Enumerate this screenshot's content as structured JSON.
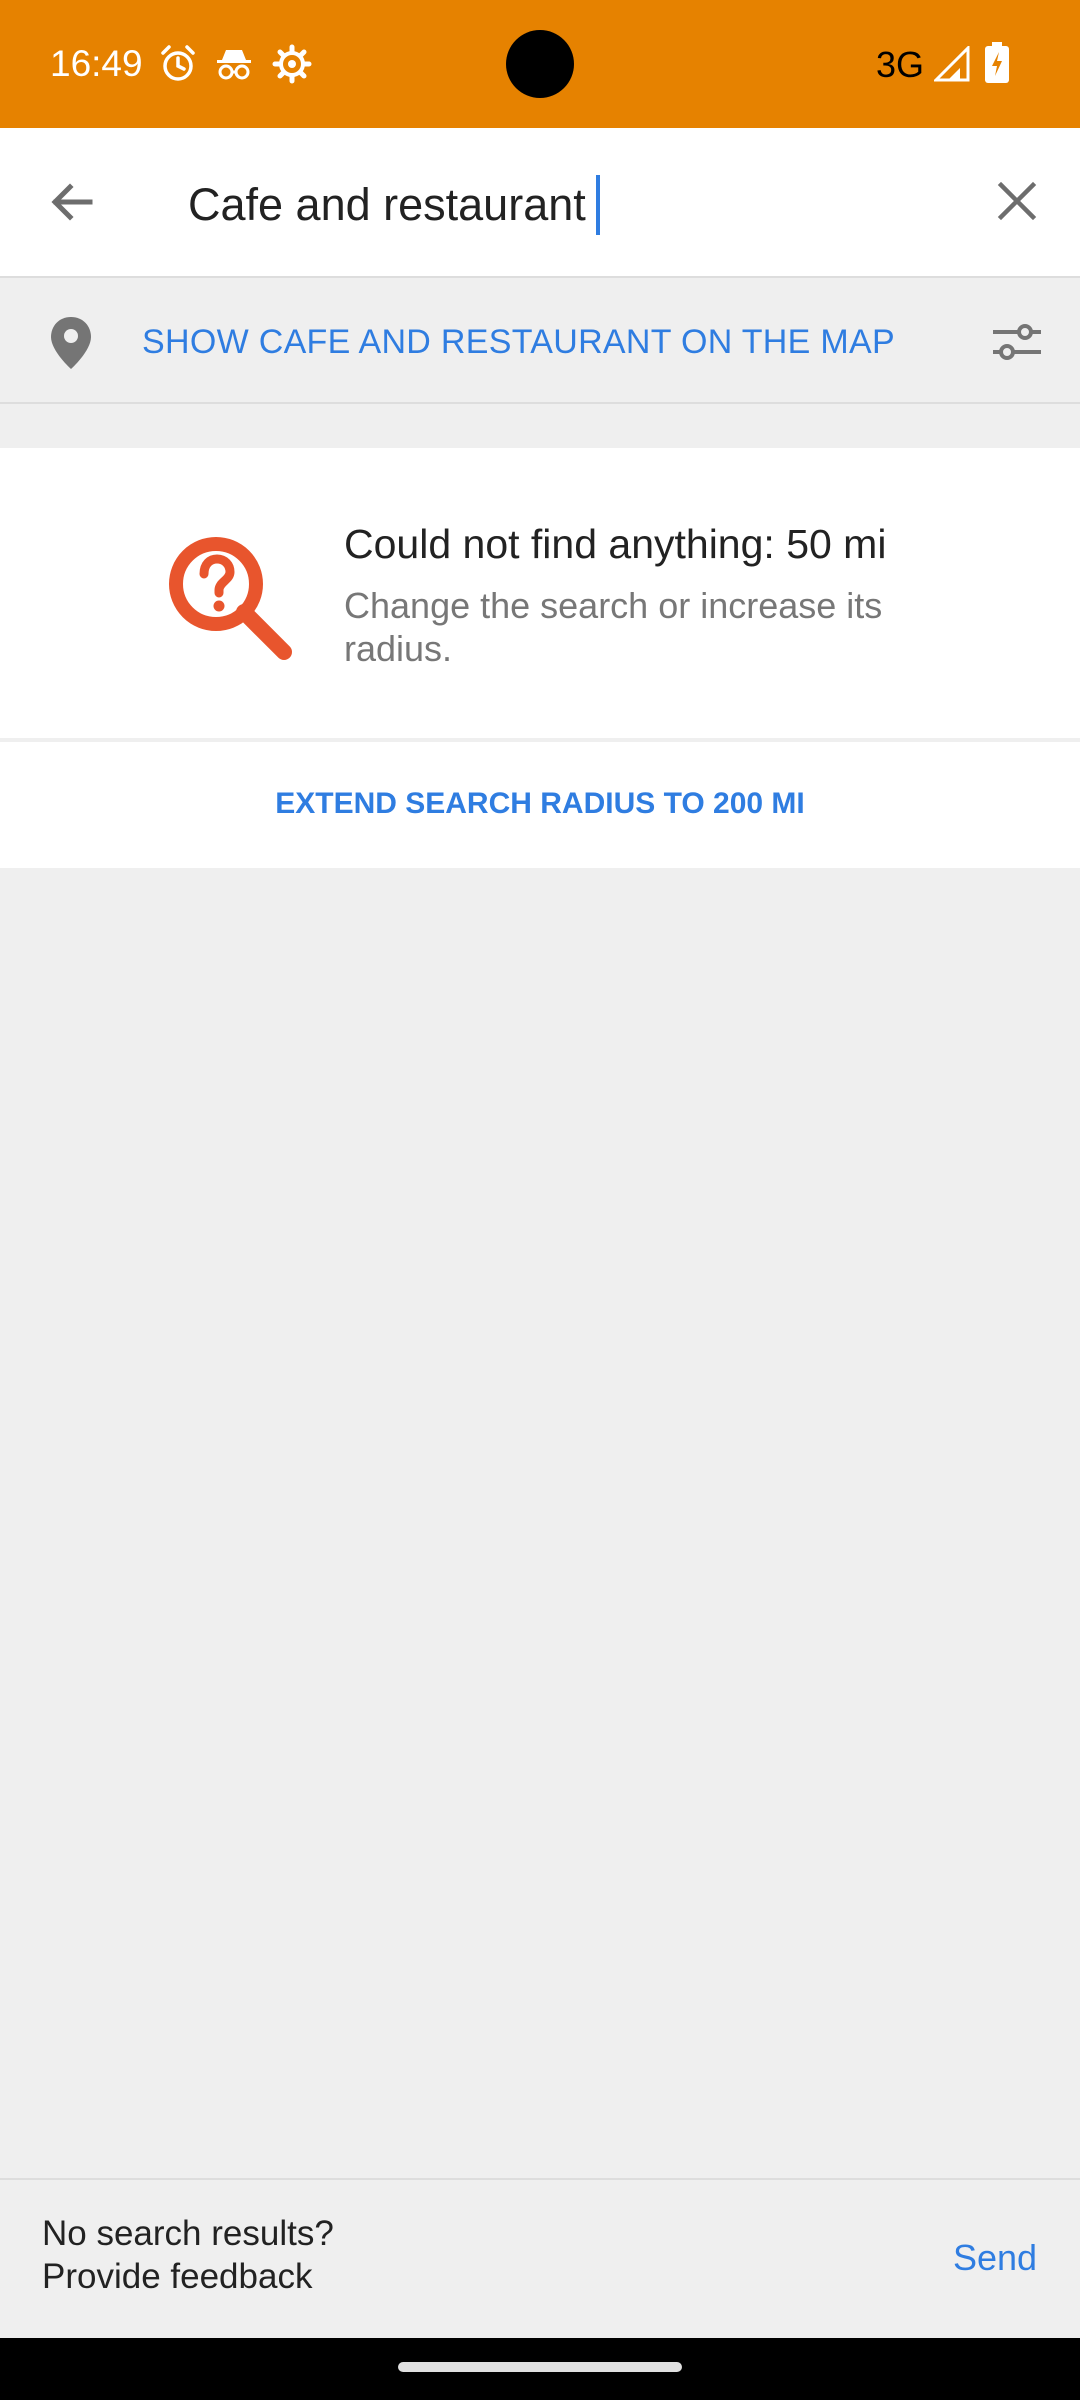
{
  "status_bar": {
    "time": "16:49",
    "network": "3G",
    "icons": [
      "alarm-icon",
      "incognito-icon",
      "settings-gear-icon",
      "signal-icon",
      "battery-charging-icon"
    ]
  },
  "search": {
    "query": "Cafe and restaurant",
    "back_icon": "arrow-left-icon",
    "clear_icon": "close-icon"
  },
  "map_bar": {
    "show_on_map_label": "SHOW CAFE AND RESTAURANT ON THE MAP",
    "pin_icon": "location-pin-icon",
    "filter_icon": "filter-sliders-icon"
  },
  "empty_state": {
    "title": "Could not find anything: 50 mi",
    "subtitle": "Change the search or increase its radius.",
    "icon": "search-question-icon"
  },
  "extend": {
    "label": "EXTEND SEARCH RADIUS TO 200 MI"
  },
  "feedback": {
    "line1": "No search results?",
    "line2": "Provide feedback",
    "send_label": "Send"
  },
  "colors": {
    "status_bar": "#e68200",
    "accent": "#2f7de1",
    "empty_icon": "#e8552d"
  }
}
